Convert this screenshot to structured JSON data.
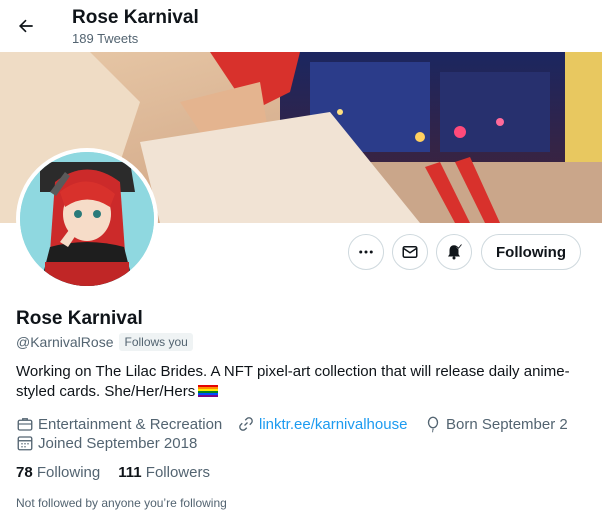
{
  "header": {
    "title": "Rose Karnival",
    "tweet_count": "189 Tweets",
    "back_icon": "arrow-left-icon"
  },
  "profile": {
    "name": "Rose Karnival",
    "handle": "@KarnivalRose",
    "follows_you": "Follows you",
    "bio": "Working on The Lilac Brides. A NFT pixel-art collection that will release daily anime-styled cards. She/Her/Hers",
    "bio_emoji": "rainbow-flag-icon",
    "category": "Entertainment & Recreation",
    "website": "linktr.ee/karnivalhouse",
    "birthday": "Born September 2",
    "joined": "Joined September 2018",
    "following_count": "78",
    "following_label": "Following",
    "followers_count": "111",
    "followers_label": "Followers",
    "not_followed_note": "Not followed by anyone you’re following"
  },
  "actions": {
    "more_icon": "more-icon",
    "message_icon": "message-icon",
    "notifications_icon": "bell-check-icon",
    "follow_label": "Following"
  },
  "colors": {
    "accent": "#1d9bf0",
    "text": "#0f1419",
    "muted": "#536471",
    "border": "#cfd9de"
  }
}
